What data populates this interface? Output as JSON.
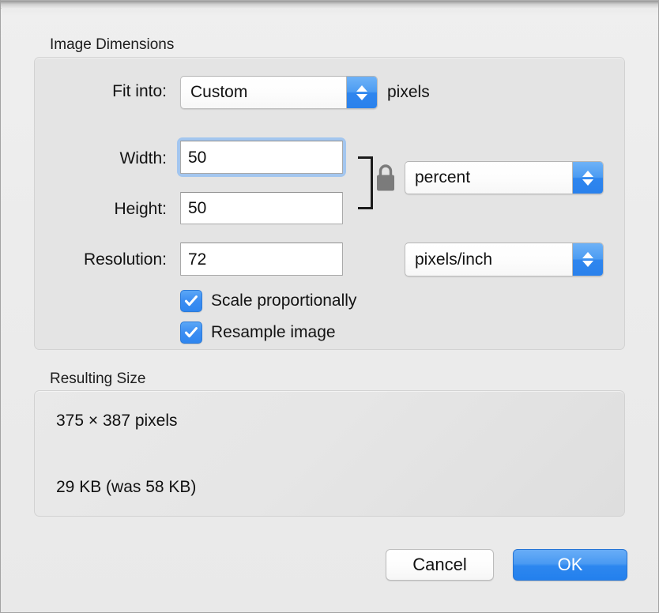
{
  "window": {
    "title": ""
  },
  "dimensions_group": {
    "label": "Image Dimensions",
    "fit_into": {
      "label": "Fit into:",
      "selected": "Custom",
      "unit_suffix": "pixels"
    },
    "width": {
      "label": "Width:",
      "value": "50"
    },
    "height": {
      "label": "Height:",
      "value": "50"
    },
    "link_lock": {
      "icon": "lock-closed-icon"
    },
    "size_unit": {
      "selected": "percent"
    },
    "resolution": {
      "label": "Resolution:",
      "value": "72"
    },
    "resolution_unit": {
      "selected": "pixels/inch"
    },
    "checkboxes": [
      {
        "label": "Scale proportionally",
        "checked": true
      },
      {
        "label": "Resample image",
        "checked": true
      }
    ]
  },
  "resulting_group": {
    "label": "Resulting Size",
    "dimensions_text": "375 × 387 pixels",
    "filesize_text": "29 KB (was 58 KB)"
  },
  "footer": {
    "cancel_label": "Cancel",
    "ok_label": "OK"
  },
  "colors": {
    "accent_blue": "#2d87ef",
    "focus_ring": "#a3c6ef",
    "window_bg": "#ececec",
    "group_bg": "#e4e4e4"
  }
}
